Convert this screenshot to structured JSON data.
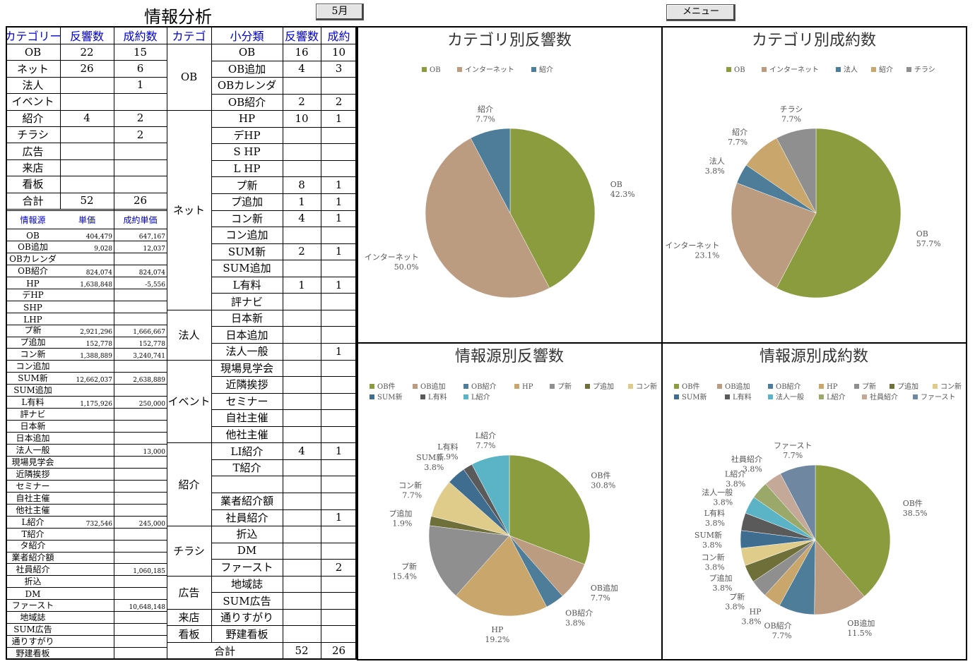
{
  "header": {
    "title": "情報分析",
    "month": "5月",
    "menu_label": "メニュー"
  },
  "cat_table": {
    "headers": [
      "カテゴリー",
      "反響数",
      "成約数"
    ],
    "rows": [
      {
        "name": "OB",
        "res": "22",
        "con": "15"
      },
      {
        "name": "ネット",
        "res": "26",
        "con": "6"
      },
      {
        "name": "法人",
        "res": "",
        "con": "1"
      },
      {
        "name": "イベント",
        "res": "",
        "con": ""
      },
      {
        "name": "紹介",
        "res": "4",
        "con": "2"
      },
      {
        "name": "チラシ",
        "res": "",
        "con": "2"
      },
      {
        "name": "広告",
        "res": "",
        "con": ""
      },
      {
        "name": "来店",
        "res": "",
        "con": ""
      },
      {
        "name": "看板",
        "res": "",
        "con": ""
      },
      {
        "name": "合計",
        "res": "52",
        "con": "26"
      }
    ]
  },
  "price_table": {
    "headers": [
      "情報源",
      "単価",
      "成約単価"
    ],
    "rows": [
      {
        "name": "OB",
        "price": "404,479",
        "cprice": "647,167"
      },
      {
        "name": "OB追加",
        "price": "9,028",
        "cprice": "12,037"
      },
      {
        "name": "OBカレンダ",
        "price": "",
        "cprice": ""
      },
      {
        "name": "OB紹介",
        "price": "824,074",
        "cprice": "824,074"
      },
      {
        "name": "HP",
        "price": "1,638,848",
        "cprice": "-5,556"
      },
      {
        "name": "デHP",
        "price": "",
        "cprice": ""
      },
      {
        "name": "SHP",
        "price": "",
        "cprice": ""
      },
      {
        "name": "LHP",
        "price": "",
        "cprice": ""
      },
      {
        "name": "プ新",
        "price": "2,921,296",
        "cprice": "1,666,667"
      },
      {
        "name": "プ追加",
        "price": "152,778",
        "cprice": "152,778"
      },
      {
        "name": "コン新",
        "price": "1,388,889",
        "cprice": "3,240,741"
      },
      {
        "name": "コン追加",
        "price": "",
        "cprice": ""
      },
      {
        "name": "SUM新",
        "price": "12,662,037",
        "cprice": "2,638,889"
      },
      {
        "name": "SUM追加",
        "price": "",
        "cprice": ""
      },
      {
        "name": "L有料",
        "price": "1,175,926",
        "cprice": "250,000"
      },
      {
        "name": "評ナビ",
        "price": "",
        "cprice": ""
      },
      {
        "name": "日本新",
        "price": "",
        "cprice": ""
      },
      {
        "name": "日本追加",
        "price": "",
        "cprice": ""
      },
      {
        "name": "法人一般",
        "price": "",
        "cprice": "13,000"
      },
      {
        "name": "現場見学会",
        "price": "",
        "cprice": ""
      },
      {
        "name": "近隣挨拶",
        "price": "",
        "cprice": ""
      },
      {
        "name": "セミナー",
        "price": "",
        "cprice": ""
      },
      {
        "name": "自社主催",
        "price": "",
        "cprice": ""
      },
      {
        "name": "他社主催",
        "price": "",
        "cprice": ""
      },
      {
        "name": "L紹介",
        "price": "732,546",
        "cprice": "245,000"
      },
      {
        "name": "T紹介",
        "price": "",
        "cprice": ""
      },
      {
        "name": "タ紹介",
        "price": "",
        "cprice": ""
      },
      {
        "name": "業者紹介額",
        "price": "",
        "cprice": ""
      },
      {
        "name": "社員紹介",
        "price": "",
        "cprice": "1,060,185"
      },
      {
        "name": "折込",
        "price": "",
        "cprice": ""
      },
      {
        "name": "DM",
        "price": "",
        "cprice": ""
      },
      {
        "name": "ファースト",
        "price": "",
        "cprice": "10,648,148"
      },
      {
        "name": "地域誌",
        "price": "",
        "cprice": ""
      },
      {
        "name": "SUM広告",
        "price": "",
        "cprice": ""
      },
      {
        "name": "通りすがり",
        "price": "",
        "cprice": ""
      },
      {
        "name": "野建看板",
        "price": "",
        "cprice": ""
      }
    ]
  },
  "sub_table": {
    "headers": [
      "カテゴ",
      "小分類",
      "反響数",
      "成約"
    ],
    "groups": [
      {
        "name": "OB",
        "span": 4
      },
      {
        "name": "ネット",
        "span": 12
      },
      {
        "name": "法人",
        "span": 3
      },
      {
        "name": "イベント",
        "span": 5
      },
      {
        "name": "紹介",
        "span": 5
      },
      {
        "name": "チラシ",
        "span": 3
      },
      {
        "name": "広告",
        "span": 2
      },
      {
        "name": "来店",
        "span": 1
      },
      {
        "name": "看板",
        "span": 1
      }
    ],
    "rows": [
      {
        "name": "OB",
        "res": "16",
        "con": "10"
      },
      {
        "name": "OB追加",
        "res": "4",
        "con": "3"
      },
      {
        "name": "OBカレンダ",
        "res": "",
        "con": ""
      },
      {
        "name": "OB紹介",
        "res": "2",
        "con": "2"
      },
      {
        "name": "HP",
        "res": "10",
        "con": "1"
      },
      {
        "name": "デHP",
        "res": "",
        "con": ""
      },
      {
        "name": "S HP",
        "res": "",
        "con": ""
      },
      {
        "name": "L HP",
        "res": "",
        "con": ""
      },
      {
        "name": "プ新",
        "res": "8",
        "con": "1"
      },
      {
        "name": "プ追加",
        "res": "1",
        "con": "1"
      },
      {
        "name": "コン新",
        "res": "4",
        "con": "1"
      },
      {
        "name": "コン追加",
        "res": "",
        "con": ""
      },
      {
        "name": "SUM新",
        "res": "2",
        "con": "1"
      },
      {
        "name": "SUM追加",
        "res": "",
        "con": ""
      },
      {
        "name": "L有料",
        "res": "1",
        "con": "1"
      },
      {
        "name": "評ナビ",
        "res": "",
        "con": ""
      },
      {
        "name": "日本新",
        "res": "",
        "con": ""
      },
      {
        "name": "日本追加",
        "res": "",
        "con": ""
      },
      {
        "name": "法人一般",
        "res": "",
        "con": "1"
      },
      {
        "name": "現場見学会",
        "res": "",
        "con": ""
      },
      {
        "name": "近隣挨拶",
        "res": "",
        "con": ""
      },
      {
        "name": "セミナー",
        "res": "",
        "con": ""
      },
      {
        "name": "自社主催",
        "res": "",
        "con": ""
      },
      {
        "name": "他社主催",
        "res": "",
        "con": ""
      },
      {
        "name": "LI紹介",
        "res": "4",
        "con": "1"
      },
      {
        "name": "T紹介",
        "res": "",
        "con": ""
      },
      {
        "name": "",
        "res": "",
        "con": ""
      },
      {
        "name": "業者紹介額",
        "res": "",
        "con": ""
      },
      {
        "name": "社員紹介",
        "res": "",
        "con": "1"
      },
      {
        "name": "折込",
        "res": "",
        "con": ""
      },
      {
        "name": "DM",
        "res": "",
        "con": ""
      },
      {
        "name": "ファースト",
        "res": "",
        "con": "2"
      },
      {
        "name": "地域誌",
        "res": "",
        "con": ""
      },
      {
        "name": "SUM広告",
        "res": "",
        "con": ""
      },
      {
        "name": "通りすがり",
        "res": "",
        "con": ""
      },
      {
        "name": "野建看板",
        "res": "",
        "con": ""
      }
    ],
    "total": {
      "label": "合計",
      "res": "52",
      "con": "26"
    }
  },
  "chart_data": [
    {
      "type": "pie",
      "title": "カテゴリ別反響数",
      "legend": "top",
      "slices": [
        {
          "name": "OB",
          "pct": "42.3%",
          "value": 42.3,
          "color": "#8b9c3e"
        },
        {
          "name": "インターネット",
          "pct": "50.0%",
          "value": 50.0,
          "color": "#bc9c80"
        },
        {
          "name": "紹介",
          "pct": "7.7%",
          "value": 7.7,
          "color": "#4e7d9a"
        }
      ]
    },
    {
      "type": "pie",
      "title": "カテゴリ別成約数",
      "legend": "top",
      "slices": [
        {
          "name": "OB",
          "pct": "57.7%",
          "value": 57.7,
          "color": "#8b9c3e"
        },
        {
          "name": "インターネット",
          "pct": "23.1%",
          "value": 23.1,
          "color": "#bc9c80"
        },
        {
          "name": "法人",
          "pct": "3.8%",
          "value": 3.8,
          "color": "#4e7d9a"
        },
        {
          "name": "紹介",
          "pct": "7.7%",
          "value": 7.7,
          "color": "#c9a66b"
        },
        {
          "name": "チラシ",
          "pct": "7.7%",
          "value": 7.7,
          "color": "#8f8f8f"
        }
      ]
    },
    {
      "type": "pie",
      "title": "情報源別反響数",
      "legend": "top",
      "legend_items": [
        {
          "name": "OB件",
          "color": "#8b9c3e"
        },
        {
          "name": "OB追加",
          "color": "#bc9c80"
        },
        {
          "name": "OB紹介",
          "color": "#4e7d9a"
        },
        {
          "name": "HP",
          "color": "#c9a66b"
        },
        {
          "name": "プ新",
          "color": "#8f8f8f"
        },
        {
          "name": "プ追加",
          "color": "#6f6f3a"
        },
        {
          "name": "コン新",
          "color": "#e0cc8a"
        },
        {
          "name": "SUM新",
          "color": "#3f6d8f"
        },
        {
          "name": "L有料",
          "color": "#5a5a5a"
        },
        {
          "name": "L紹介",
          "color": "#5ab4c6"
        }
      ],
      "slices": [
        {
          "name": "OB件",
          "pct": "30.8%",
          "value": 30.8,
          "color": "#8b9c3e"
        },
        {
          "name": "OB追加",
          "pct": "7.7%",
          "value": 7.7,
          "color": "#bc9c80"
        },
        {
          "name": "OB紹介",
          "pct": "3.8%",
          "value": 3.8,
          "color": "#4e7d9a"
        },
        {
          "name": "HP",
          "pct": "19.2%",
          "value": 19.2,
          "color": "#c9a66b"
        },
        {
          "name": "プ新",
          "pct": "15.4%",
          "value": 15.4,
          "color": "#8f8f8f"
        },
        {
          "name": "プ追加",
          "pct": "1.9%",
          "value": 1.9,
          "color": "#6f6f3a"
        },
        {
          "name": "コン新",
          "pct": "7.7%",
          "value": 7.7,
          "color": "#e0cc8a"
        },
        {
          "name": "SUM新",
          "pct": "3.8%",
          "value": 3.8,
          "color": "#3f6d8f"
        },
        {
          "name": "L有料",
          "pct": "1.9%",
          "value": 1.9,
          "color": "#5a5a5a"
        },
        {
          "name": "L紹介",
          "pct": "7.7%",
          "value": 7.7,
          "color": "#5ab4c6"
        }
      ]
    },
    {
      "type": "pie",
      "title": "情報源別成約数",
      "legend": "top",
      "legend_items": [
        {
          "name": "OB件",
          "color": "#8b9c3e"
        },
        {
          "name": "OB追加",
          "color": "#bc9c80"
        },
        {
          "name": "OB紹介",
          "color": "#4e7d9a"
        },
        {
          "name": "HP",
          "color": "#c9a66b"
        },
        {
          "name": "プ新",
          "color": "#8f8f8f"
        },
        {
          "name": "プ追加",
          "color": "#6f6f3a"
        },
        {
          "name": "コン新",
          "color": "#e0cc8a"
        },
        {
          "name": "SUM新",
          "color": "#3f6d8f"
        },
        {
          "name": "L有料",
          "color": "#5a5a5a"
        },
        {
          "name": "法人一般",
          "color": "#5ab4c6"
        },
        {
          "name": "L紹介",
          "color": "#9aa86a"
        },
        {
          "name": "社員紹介",
          "color": "#c4a898"
        },
        {
          "name": "ファースト",
          "color": "#6f87a0"
        }
      ],
      "slices": [
        {
          "name": "OB件",
          "pct": "38.5%",
          "value": 38.5,
          "color": "#8b9c3e"
        },
        {
          "name": "OB追加",
          "pct": "11.5%",
          "value": 11.5,
          "color": "#bc9c80"
        },
        {
          "name": "OB紹介",
          "pct": "7.7%",
          "value": 7.7,
          "color": "#4e7d9a"
        },
        {
          "name": "HP",
          "pct": "3.8%",
          "value": 3.8,
          "color": "#c9a66b"
        },
        {
          "name": "プ新",
          "pct": "3.8%",
          "value": 3.8,
          "color": "#8f8f8f"
        },
        {
          "name": "プ追加",
          "pct": "3.8%",
          "value": 3.8,
          "color": "#6f6f3a"
        },
        {
          "name": "コン新",
          "pct": "3.8%",
          "value": 3.8,
          "color": "#e0cc8a"
        },
        {
          "name": "SUM新",
          "pct": "3.8%",
          "value": 3.8,
          "color": "#3f6d8f"
        },
        {
          "name": "L有料",
          "pct": "3.8%",
          "value": 3.8,
          "color": "#5a5a5a"
        },
        {
          "name": "法人一般",
          "pct": "3.8%",
          "value": 3.8,
          "color": "#5ab4c6"
        },
        {
          "name": "L紹介",
          "pct": "3.8%",
          "value": 3.8,
          "color": "#9aa86a"
        },
        {
          "name": "社員紹介",
          "pct": "3.8%",
          "value": 3.8,
          "color": "#c4a898"
        },
        {
          "name": "ファースト",
          "pct": "7.7%",
          "value": 7.7,
          "color": "#6f87a0"
        }
      ]
    }
  ]
}
